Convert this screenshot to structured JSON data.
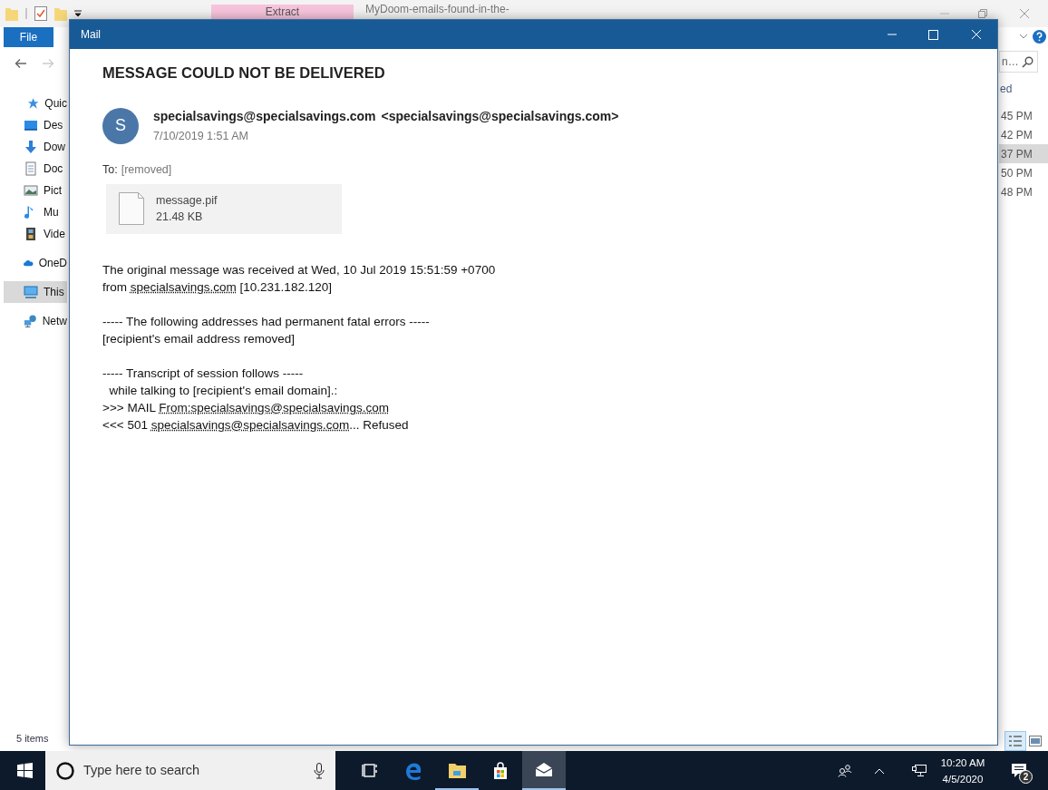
{
  "explorer": {
    "ribbon_context_tab": "Extract",
    "title": "MyDoom-emails-found-in-the-",
    "file_tab": "File",
    "search_placeholder": "n…",
    "column_header": "ed",
    "nav_items": [
      {
        "label": "Quic",
        "kind": "star",
        "selected": false
      },
      {
        "label": "Des",
        "kind": "desktop",
        "selected": false
      },
      {
        "label": "Dow",
        "kind": "download",
        "selected": false
      },
      {
        "label": "Doc",
        "kind": "document",
        "selected": false
      },
      {
        "label": "Pict",
        "kind": "picture",
        "selected": false
      },
      {
        "label": "Mu",
        "kind": "music",
        "selected": false
      },
      {
        "label": "Vide",
        "kind": "video",
        "selected": false
      },
      {
        "label": "OneD",
        "kind": "cloud",
        "selected": false
      },
      {
        "label": "This",
        "kind": "computer",
        "selected": true
      },
      {
        "label": "Netw",
        "kind": "network",
        "selected": false
      }
    ],
    "rows": [
      {
        "modified": "45 PM",
        "selected": false
      },
      {
        "modified": "42 PM",
        "selected": false
      },
      {
        "modified": "37 PM",
        "selected": true
      },
      {
        "modified": "50 PM",
        "selected": false
      },
      {
        "modified": "48 PM",
        "selected": false
      }
    ],
    "status": "5 items"
  },
  "mail": {
    "title": "Mail",
    "subject": "MESSAGE COULD NOT BE DELIVERED",
    "sender_initial": "S",
    "sender_name": "specialsavings@specialsavings.com",
    "sender_address": "<specialsavings@specialsavings.com>",
    "date": "7/10/2019 1:51 AM",
    "to_label": "To:",
    "to_value": "[removed]",
    "attachment": {
      "name": "message.pif",
      "size": "21.48 KB"
    },
    "body": [
      [
        [
          {
            "text": "The original message was received at Wed, 10 Jul 2019 15:51:59 +0700",
            "link": false
          }
        ],
        [
          {
            "text": "from ",
            "link": false
          },
          {
            "text": "specialsavings.com",
            "link": true
          },
          {
            "text": " [10.231.182.120]",
            "link": false
          }
        ]
      ],
      [
        [
          {
            "text": "----- The following addresses had permanent fatal errors -----",
            "link": false
          }
        ],
        [
          {
            "text": "[recipient's email address removed]",
            "link": false
          }
        ]
      ],
      [
        [
          {
            "text": "----- Transcript of session follows -----",
            "link": false
          }
        ],
        [
          {
            "text": "  while talking to [recipient's email domain].:",
            "link": false
          }
        ],
        [
          {
            "text": ">>> MAIL ",
            "link": false
          },
          {
            "text": "From:specialsavings@specialsavings.com",
            "link": true
          }
        ],
        [
          {
            "text": "<<< 501 ",
            "link": false
          },
          {
            "text": "specialsavings@specialsavings.com",
            "link": true
          },
          {
            "text": "... Refused",
            "link": false
          }
        ]
      ]
    ]
  },
  "taskbar": {
    "search_placeholder": "Type here to search",
    "apps": [
      {
        "kind": "task-view",
        "running": false,
        "selected": false
      },
      {
        "kind": "edge",
        "running": false,
        "selected": false
      },
      {
        "kind": "explorer",
        "running": true,
        "selected": false
      },
      {
        "kind": "store",
        "running": false,
        "selected": false
      },
      {
        "kind": "mail",
        "running": true,
        "selected": true
      }
    ],
    "time": "10:20 AM",
    "date": "4/5/2020",
    "notification_count": "2"
  }
}
